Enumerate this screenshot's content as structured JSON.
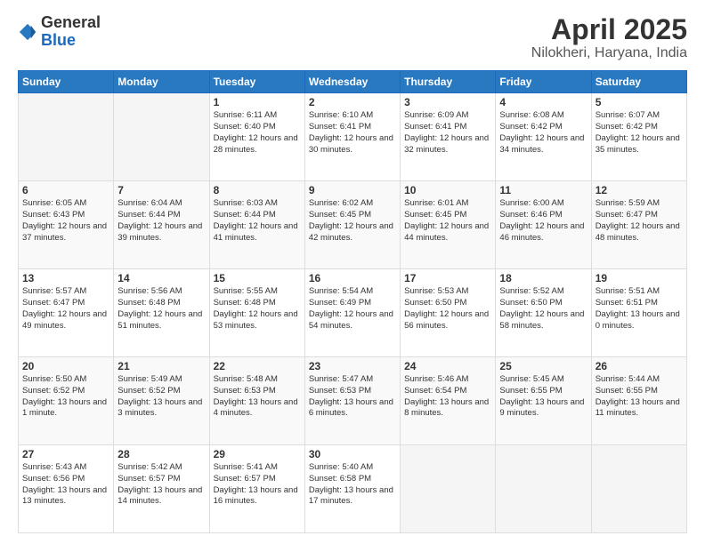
{
  "logo": {
    "general": "General",
    "blue": "Blue"
  },
  "title": "April 2025",
  "subtitle": "Nilokheri, Haryana, India",
  "days": [
    "Sunday",
    "Monday",
    "Tuesday",
    "Wednesday",
    "Thursday",
    "Friday",
    "Saturday"
  ],
  "weeks": [
    [
      {
        "day": "",
        "sunrise": "",
        "sunset": "",
        "daylight": ""
      },
      {
        "day": "",
        "sunrise": "",
        "sunset": "",
        "daylight": ""
      },
      {
        "day": "1",
        "sunrise": "Sunrise: 6:11 AM",
        "sunset": "Sunset: 6:40 PM",
        "daylight": "Daylight: 12 hours and 28 minutes."
      },
      {
        "day": "2",
        "sunrise": "Sunrise: 6:10 AM",
        "sunset": "Sunset: 6:41 PM",
        "daylight": "Daylight: 12 hours and 30 minutes."
      },
      {
        "day": "3",
        "sunrise": "Sunrise: 6:09 AM",
        "sunset": "Sunset: 6:41 PM",
        "daylight": "Daylight: 12 hours and 32 minutes."
      },
      {
        "day": "4",
        "sunrise": "Sunrise: 6:08 AM",
        "sunset": "Sunset: 6:42 PM",
        "daylight": "Daylight: 12 hours and 34 minutes."
      },
      {
        "day": "5",
        "sunrise": "Sunrise: 6:07 AM",
        "sunset": "Sunset: 6:42 PM",
        "daylight": "Daylight: 12 hours and 35 minutes."
      }
    ],
    [
      {
        "day": "6",
        "sunrise": "Sunrise: 6:05 AM",
        "sunset": "Sunset: 6:43 PM",
        "daylight": "Daylight: 12 hours and 37 minutes."
      },
      {
        "day": "7",
        "sunrise": "Sunrise: 6:04 AM",
        "sunset": "Sunset: 6:44 PM",
        "daylight": "Daylight: 12 hours and 39 minutes."
      },
      {
        "day": "8",
        "sunrise": "Sunrise: 6:03 AM",
        "sunset": "Sunset: 6:44 PM",
        "daylight": "Daylight: 12 hours and 41 minutes."
      },
      {
        "day": "9",
        "sunrise": "Sunrise: 6:02 AM",
        "sunset": "Sunset: 6:45 PM",
        "daylight": "Daylight: 12 hours and 42 minutes."
      },
      {
        "day": "10",
        "sunrise": "Sunrise: 6:01 AM",
        "sunset": "Sunset: 6:45 PM",
        "daylight": "Daylight: 12 hours and 44 minutes."
      },
      {
        "day": "11",
        "sunrise": "Sunrise: 6:00 AM",
        "sunset": "Sunset: 6:46 PM",
        "daylight": "Daylight: 12 hours and 46 minutes."
      },
      {
        "day": "12",
        "sunrise": "Sunrise: 5:59 AM",
        "sunset": "Sunset: 6:47 PM",
        "daylight": "Daylight: 12 hours and 48 minutes."
      }
    ],
    [
      {
        "day": "13",
        "sunrise": "Sunrise: 5:57 AM",
        "sunset": "Sunset: 6:47 PM",
        "daylight": "Daylight: 12 hours and 49 minutes."
      },
      {
        "day": "14",
        "sunrise": "Sunrise: 5:56 AM",
        "sunset": "Sunset: 6:48 PM",
        "daylight": "Daylight: 12 hours and 51 minutes."
      },
      {
        "day": "15",
        "sunrise": "Sunrise: 5:55 AM",
        "sunset": "Sunset: 6:48 PM",
        "daylight": "Daylight: 12 hours and 53 minutes."
      },
      {
        "day": "16",
        "sunrise": "Sunrise: 5:54 AM",
        "sunset": "Sunset: 6:49 PM",
        "daylight": "Daylight: 12 hours and 54 minutes."
      },
      {
        "day": "17",
        "sunrise": "Sunrise: 5:53 AM",
        "sunset": "Sunset: 6:50 PM",
        "daylight": "Daylight: 12 hours and 56 minutes."
      },
      {
        "day": "18",
        "sunrise": "Sunrise: 5:52 AM",
        "sunset": "Sunset: 6:50 PM",
        "daylight": "Daylight: 12 hours and 58 minutes."
      },
      {
        "day": "19",
        "sunrise": "Sunrise: 5:51 AM",
        "sunset": "Sunset: 6:51 PM",
        "daylight": "Daylight: 13 hours and 0 minutes."
      }
    ],
    [
      {
        "day": "20",
        "sunrise": "Sunrise: 5:50 AM",
        "sunset": "Sunset: 6:52 PM",
        "daylight": "Daylight: 13 hours and 1 minute."
      },
      {
        "day": "21",
        "sunrise": "Sunrise: 5:49 AM",
        "sunset": "Sunset: 6:52 PM",
        "daylight": "Daylight: 13 hours and 3 minutes."
      },
      {
        "day": "22",
        "sunrise": "Sunrise: 5:48 AM",
        "sunset": "Sunset: 6:53 PM",
        "daylight": "Daylight: 13 hours and 4 minutes."
      },
      {
        "day": "23",
        "sunrise": "Sunrise: 5:47 AM",
        "sunset": "Sunset: 6:53 PM",
        "daylight": "Daylight: 13 hours and 6 minutes."
      },
      {
        "day": "24",
        "sunrise": "Sunrise: 5:46 AM",
        "sunset": "Sunset: 6:54 PM",
        "daylight": "Daylight: 13 hours and 8 minutes."
      },
      {
        "day": "25",
        "sunrise": "Sunrise: 5:45 AM",
        "sunset": "Sunset: 6:55 PM",
        "daylight": "Daylight: 13 hours and 9 minutes."
      },
      {
        "day": "26",
        "sunrise": "Sunrise: 5:44 AM",
        "sunset": "Sunset: 6:55 PM",
        "daylight": "Daylight: 13 hours and 11 minutes."
      }
    ],
    [
      {
        "day": "27",
        "sunrise": "Sunrise: 5:43 AM",
        "sunset": "Sunset: 6:56 PM",
        "daylight": "Daylight: 13 hours and 13 minutes."
      },
      {
        "day": "28",
        "sunrise": "Sunrise: 5:42 AM",
        "sunset": "Sunset: 6:57 PM",
        "daylight": "Daylight: 13 hours and 14 minutes."
      },
      {
        "day": "29",
        "sunrise": "Sunrise: 5:41 AM",
        "sunset": "Sunset: 6:57 PM",
        "daylight": "Daylight: 13 hours and 16 minutes."
      },
      {
        "day": "30",
        "sunrise": "Sunrise: 5:40 AM",
        "sunset": "Sunset: 6:58 PM",
        "daylight": "Daylight: 13 hours and 17 minutes."
      },
      {
        "day": "",
        "sunrise": "",
        "sunset": "",
        "daylight": ""
      },
      {
        "day": "",
        "sunrise": "",
        "sunset": "",
        "daylight": ""
      },
      {
        "day": "",
        "sunrise": "",
        "sunset": "",
        "daylight": ""
      }
    ]
  ]
}
